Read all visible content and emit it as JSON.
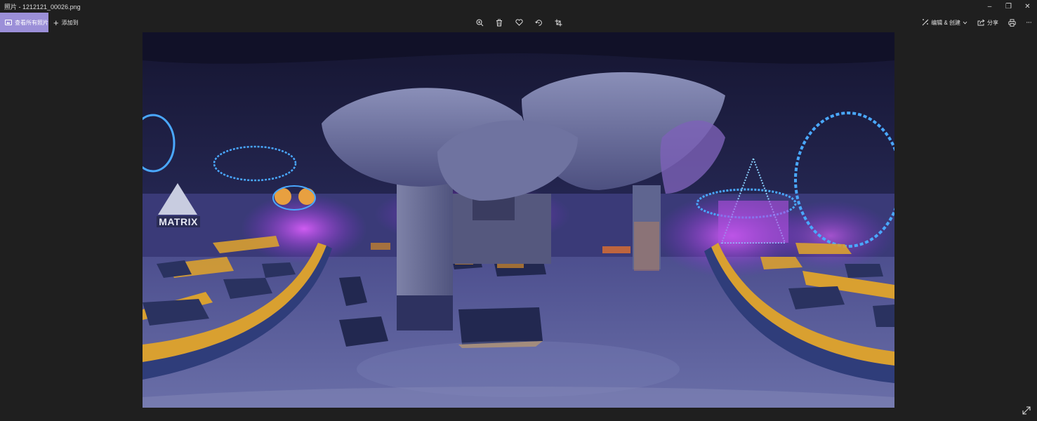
{
  "window": {
    "title": "照片 - 1212121_00026.png",
    "minimize": "–",
    "restore": "❐",
    "close": "✕"
  },
  "toolbar": {
    "view_all_label": "查看所有照片",
    "add_to_label": "添加到",
    "edit_create_label": "编辑 & 创建",
    "share_label": "分享",
    "more_label": "···",
    "icons": [
      "zoom-in-icon",
      "delete-icon",
      "favorite-icon",
      "rotate-icon",
      "crop-icon"
    ]
  },
  "photo": {
    "sign_text": "MATRIX"
  },
  "colors": {
    "accent": "#9b8fd8",
    "background": "#1f1f1f"
  }
}
